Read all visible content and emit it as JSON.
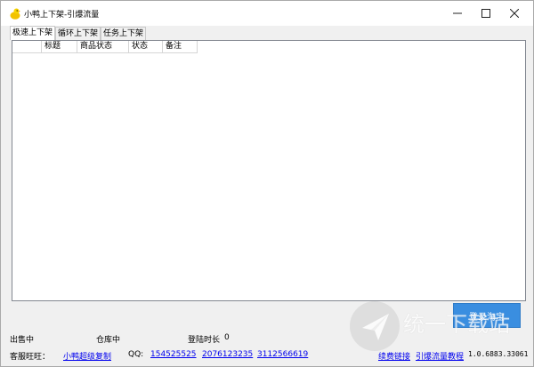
{
  "window": {
    "title": "小鸭上下架-引爆流量"
  },
  "tabs": [
    {
      "label": "极速上下架",
      "active": true
    },
    {
      "label": "循环上下架",
      "active": false
    },
    {
      "label": "任务上下架",
      "active": false
    }
  ],
  "table": {
    "columns": [
      "",
      "标题",
      "商品状态",
      "状态",
      "备注"
    ],
    "rows": []
  },
  "status": {
    "on_sale_label": "出售中",
    "warehouse_label": "仓库中",
    "login_duration_label": "登陆时长",
    "login_duration_value": "0"
  },
  "login_button_label": "登录淘宝",
  "footer": {
    "service_label": "客服旺旺：",
    "service_link": "小鸭超级复制",
    "qq_label": "QQ:",
    "qq_numbers": [
      "154525525",
      "2076123235",
      "3112566619"
    ],
    "link_renew": "续费链接",
    "link_tutorial": "引爆流量教程",
    "version": "1.0.6883.33061"
  },
  "watermark": {
    "text": "统一下载站"
  },
  "colors": {
    "accent": "#3a8ee0",
    "link": "#0000ee"
  }
}
